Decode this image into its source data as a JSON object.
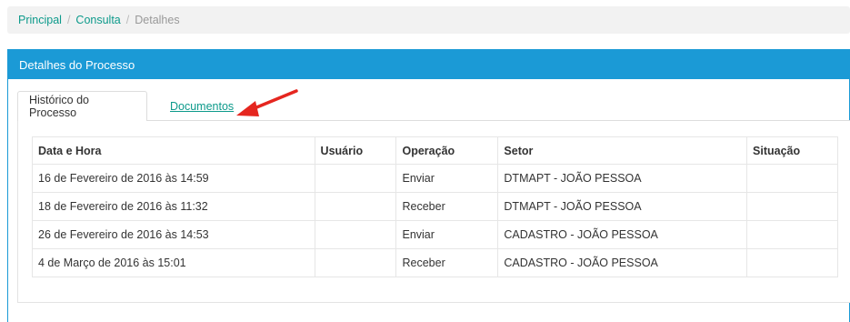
{
  "breadcrumb": {
    "items": [
      "Principal",
      "Consulta"
    ],
    "separator": "/",
    "current": "Detalhes"
  },
  "panel": {
    "title": "Detalhes do Processo"
  },
  "tabs": {
    "active": "Histórico do Processo",
    "other": "Documentos"
  },
  "table": {
    "headers": [
      "Data e Hora",
      "Usuário",
      "Operação",
      "Setor",
      "Situação"
    ],
    "rows": [
      [
        "16 de Fevereiro de 2016 às 14:59",
        "",
        "Enviar",
        "DTMAPT - JOÃO PESSOA",
        ""
      ],
      [
        "18 de Fevereiro de 2016 às 11:32",
        "",
        "Receber",
        "DTMAPT - JOÃO PESSOA",
        ""
      ],
      [
        "26 de Fevereiro de 2016 às 14:53",
        "",
        "Enviar",
        "CADASTRO - JOÃO PESSOA",
        ""
      ],
      [
        "4 de Março de 2016 às 15:01",
        "",
        "Receber",
        "CADASTRO - JOÃO PESSOA",
        ""
      ]
    ]
  },
  "colors": {
    "accent": "#1b9ad6",
    "link": "#0d9a8b",
    "annotation_arrow": "#e5261f"
  },
  "icons": {
    "annotation": "red-arrow-icon"
  }
}
